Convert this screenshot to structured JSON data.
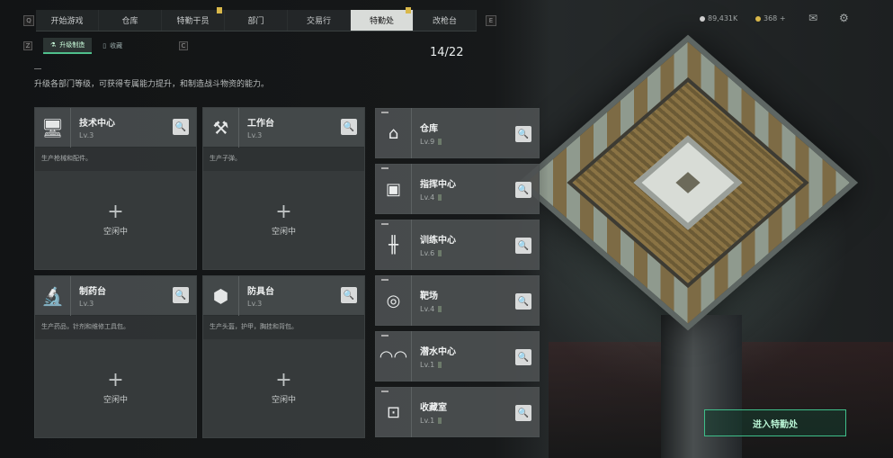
{
  "topnav": {
    "tabs": [
      "开始游戏",
      "仓库",
      "特勤干员",
      "部门",
      "交易行",
      "特勤处",
      "改枪台"
    ],
    "active_index": 5,
    "prev_key": "Q",
    "next_key": "E"
  },
  "subnav": {
    "tabs": [
      "升级制造",
      "收藏"
    ],
    "prev_key": "Z",
    "next_key": "C"
  },
  "counter": "14/22",
  "description": "升级各部门等级，可获得专属能力提升，和制造战斗物资的能力。",
  "currency": {
    "coins": "89,431K",
    "premium": "368 +"
  },
  "stations": [
    {
      "name": "技术中心",
      "level": "Lv.3",
      "desc": "生产枪械和配件。",
      "status": "空闲中",
      "icon": "computer-icon"
    },
    {
      "name": "工作台",
      "level": "Lv.3",
      "desc": "生产子弹。",
      "status": "空闲中",
      "icon": "tools-icon"
    },
    {
      "name": "制药台",
      "level": "Lv.3",
      "desc": "生产药品，针剂和维修工具包。",
      "status": "空闲中",
      "icon": "microscope-icon"
    },
    {
      "name": "防具台",
      "level": "Lv.3",
      "desc": "生产头盔，护甲，胸挂和背包。",
      "status": "空闲中",
      "icon": "armor-blocks-icon"
    }
  ],
  "departments": [
    {
      "name": "仓库",
      "level": "Lv.9",
      "icon": "warehouse-icon"
    },
    {
      "name": "指挥中心",
      "level": "Lv.4",
      "icon": "chip-icon"
    },
    {
      "name": "训练中心",
      "level": "Lv.6",
      "icon": "dumbbell-icon"
    },
    {
      "name": "靶场",
      "level": "Lv.4",
      "icon": "target-icon"
    },
    {
      "name": "潜水中心",
      "level": "Lv.1",
      "icon": "diving-mask-icon"
    },
    {
      "name": "收藏室",
      "level": "Lv.1",
      "icon": "display-case-icon"
    }
  ],
  "enter_button": "进入特勤处",
  "colors": {
    "accent": "#3fbf8a",
    "active_tab": "#d9dcd9",
    "pin": "#d9b84a"
  }
}
